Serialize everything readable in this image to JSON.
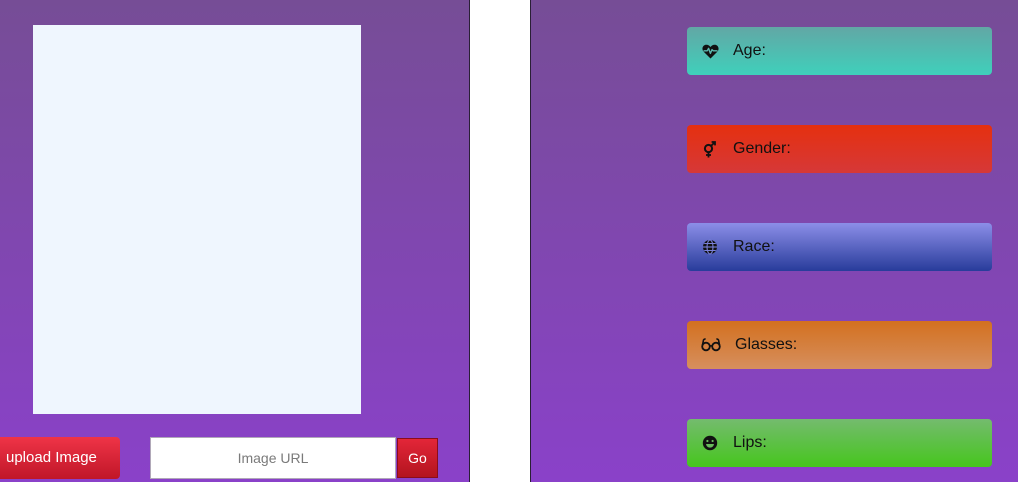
{
  "upload": {
    "button_label": "upload Image"
  },
  "url": {
    "placeholder": "Image URL",
    "value": "",
    "go_label": "Go"
  },
  "attributes": [
    {
      "icon": "heartbeat-icon",
      "label": "Age:",
      "value": ""
    },
    {
      "icon": "gender-icon",
      "label": "Gender:",
      "value": ""
    },
    {
      "icon": "globe-icon",
      "label": "Race:",
      "value": ""
    },
    {
      "icon": "glasses-icon",
      "label": "Glasses:",
      "value": ""
    },
    {
      "icon": "smile-icon",
      "label": "Lips:",
      "value": ""
    }
  ],
  "colors": {
    "panel_top": "#764d96",
    "panel_bottom": "#8a41c9",
    "preview_bg": "#eff6fe",
    "upload_button": "#e3293d",
    "go_button": "#c81c2b",
    "age": "#4fc0b2",
    "gender": "#e03322",
    "race": "#4a5cc2",
    "glasses": "#d47d3c",
    "lips": "#5cc145"
  }
}
